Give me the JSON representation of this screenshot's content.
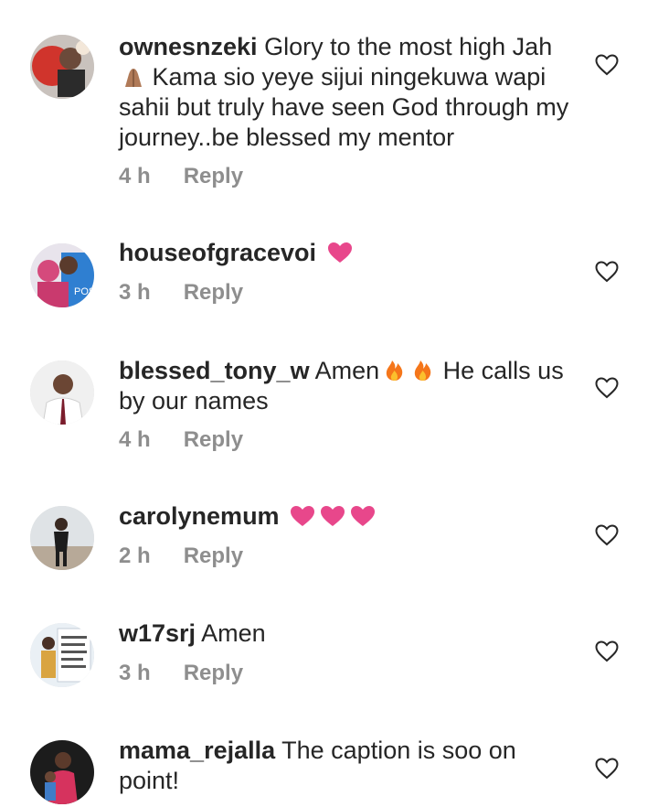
{
  "comments": [
    {
      "username": "ownesnzeki",
      "text_before": "Glory to the most high Jah ",
      "emoji_mid": "folded-hands",
      "text_after": " Kama sio yeye sijui ningekuwa wapi sahii but truly have seen God through my journey..be blessed my mentor",
      "time": "4 h",
      "reply_label": "Reply"
    },
    {
      "username": "houseofgracevoi",
      "text": "",
      "emojis": [
        "heart"
      ],
      "time": "3 h",
      "reply_label": "Reply"
    },
    {
      "username": "blessed_tony_w",
      "text_before": "Amen",
      "emojis": [
        "fire",
        "fire"
      ],
      "text_after": " He calls us by our names",
      "time": "4 h",
      "reply_label": "Reply"
    },
    {
      "username": "carolynemum",
      "text": "",
      "emojis": [
        "heart",
        "heart",
        "heart"
      ],
      "time": "2 h",
      "reply_label": "Reply"
    },
    {
      "username": "w17srj",
      "text": "Amen",
      "time": "3 h",
      "reply_label": "Reply"
    },
    {
      "username": "mama_rejalla",
      "text": "The caption is soo on point!",
      "time": "",
      "reply_label": ""
    }
  ],
  "icons": {
    "like": "heart-outline-icon",
    "heart_emoji_color": "#e8478b",
    "fire_emoji_color": "#f5761a"
  }
}
